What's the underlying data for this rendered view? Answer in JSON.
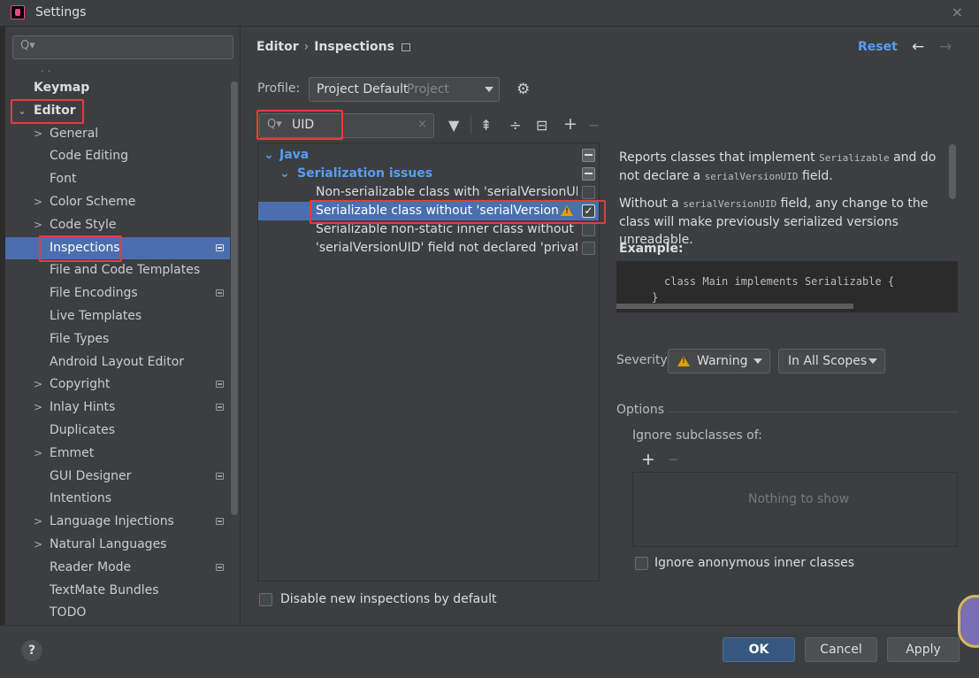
{
  "window": {
    "title": "Settings",
    "close_glyph": "×"
  },
  "sidebar": {
    "search_placeholder": "Q▾",
    "ellipsis": ". .",
    "items": [
      {
        "label": "Keymap",
        "arrow": "",
        "bold": true
      },
      {
        "label": "Editor",
        "arrow": "⌄",
        "bold": true
      },
      {
        "label": "General",
        "arrow": ">"
      },
      {
        "label": "Code Editing",
        "arrow": ""
      },
      {
        "label": "Font",
        "arrow": ""
      },
      {
        "label": "Color Scheme",
        "arrow": ">"
      },
      {
        "label": "Code Style",
        "arrow": ">"
      },
      {
        "label": "Inspections",
        "arrow": "",
        "selected": true,
        "mark": true
      },
      {
        "label": "File and Code Templates",
        "arrow": ""
      },
      {
        "label": "File Encodings",
        "arrow": "",
        "mark": true
      },
      {
        "label": "Live Templates",
        "arrow": ""
      },
      {
        "label": "File Types",
        "arrow": ""
      },
      {
        "label": "Android Layout Editor",
        "arrow": ""
      },
      {
        "label": "Copyright",
        "arrow": ">",
        "mark": true
      },
      {
        "label": "Inlay Hints",
        "arrow": ">",
        "mark": true
      },
      {
        "label": "Duplicates",
        "arrow": ""
      },
      {
        "label": "Emmet",
        "arrow": ">"
      },
      {
        "label": "GUI Designer",
        "arrow": "",
        "mark": true
      },
      {
        "label": "Intentions",
        "arrow": ""
      },
      {
        "label": "Language Injections",
        "arrow": ">",
        "mark": true
      },
      {
        "label": "Natural Languages",
        "arrow": ">"
      },
      {
        "label": "Reader Mode",
        "arrow": "",
        "mark": true
      },
      {
        "label": "TextMate Bundles",
        "arrow": ""
      },
      {
        "label": "TODO",
        "arrow": ""
      }
    ]
  },
  "header": {
    "breadcrumb_parent": "Editor",
    "breadcrumb_sep": "›",
    "breadcrumb_current": "Inspections",
    "reset_label": "Reset",
    "back_arrow": "←",
    "forward_arrow": "→"
  },
  "profile": {
    "label": "Profile:",
    "value": "Project Default",
    "scope": "Project",
    "gear": "⚙"
  },
  "filter": {
    "search_glyph": "Q▾",
    "value": "UID",
    "clear_glyph": "×",
    "toolbar": {
      "filter": "▼",
      "expand": "⇞",
      "collapse": "÷",
      "reset": "⊟",
      "add": "+",
      "remove": "−"
    }
  },
  "inspections": {
    "java_label": "Java",
    "group_label": "Serialization issues",
    "items": [
      {
        "label": "Non-serializable class with 'serialVersionUI",
        "checked": false
      },
      {
        "label": "Serializable class without 'serialVersionUID",
        "checked": true,
        "selected": true,
        "warning": true
      },
      {
        "label": "Serializable non-static inner class without '",
        "checked": false
      },
      {
        "label": "'serialVersionUID' field not declared 'privat",
        "checked": false
      }
    ],
    "check_glyph": "✓",
    "tree_arrow": "⌄"
  },
  "disable_new": {
    "label": "Disable new inspections by default",
    "checked": false
  },
  "description": {
    "p1_a": "Reports classes that implement ",
    "p1_code": "Serializable",
    "p1_b": " and do not declare a ",
    "p1_code2": "serialVersionUID",
    "p1_c": " field.",
    "p2_a": "Without a ",
    "p2_code": "serialVersionUID",
    "p2_b": " field, any change to the class will make previously serialized versions unreadable.",
    "example_label": "Example:",
    "code_line1": "class Main implements Serializable {",
    "code_line2": "}"
  },
  "severity": {
    "label": "Severity:",
    "value": "Warning",
    "scope": "In All Scopes"
  },
  "options": {
    "section_label": "Options",
    "ignore_subclasses_label": "Ignore subclasses of:",
    "add": "+",
    "remove": "−",
    "empty_text": "Nothing to show",
    "ignore_anonymous_label": "Ignore anonymous inner classes",
    "ignore_anonymous_checked": false
  },
  "footer": {
    "help": "?",
    "ok": "OK",
    "cancel": "Cancel",
    "apply": "Apply"
  }
}
